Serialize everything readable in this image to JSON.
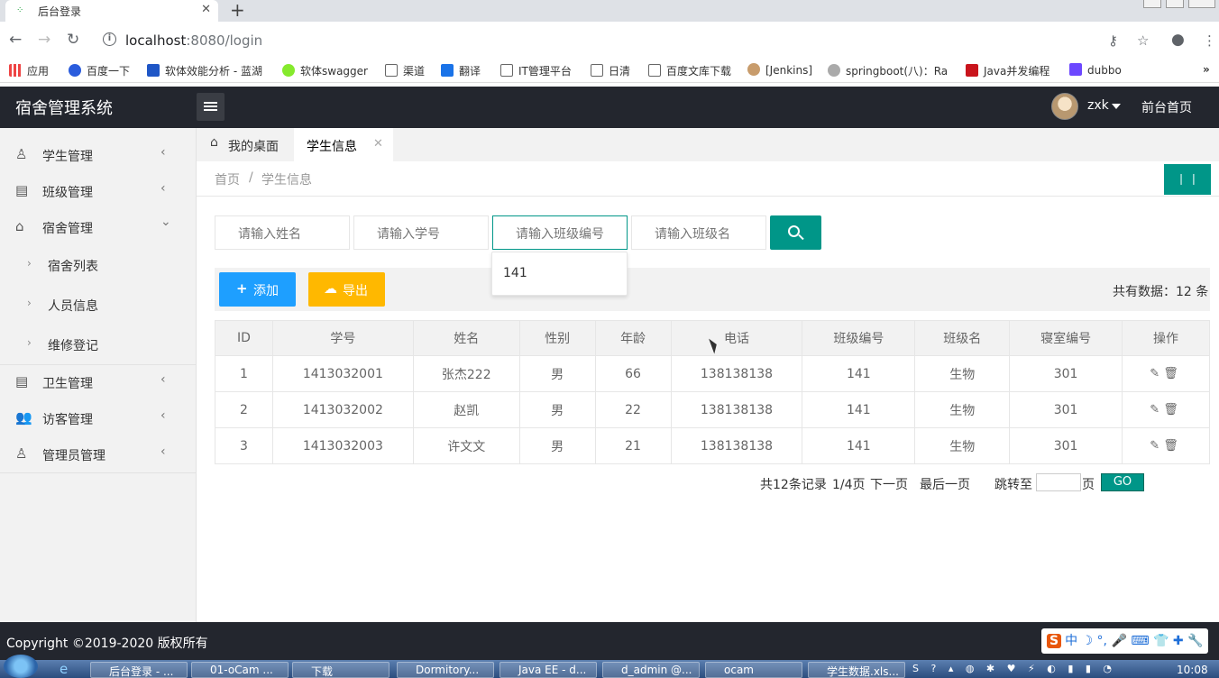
{
  "browser": {
    "tab_title": "后台登录",
    "url_host": "localhost",
    "url_path": ":8080/login",
    "bookmarks": [
      "应用",
      "百度一下",
      "软体效能分析 - 蓝湖",
      "软体swagger",
      "渠道",
      "翻译",
      "IT管理平台",
      "日清",
      "百度文库下载",
      "[Jenkins]",
      "springboot(八)：Ra",
      "Java并发编程",
      "dubbo"
    ]
  },
  "header": {
    "logo": "宿舍管理系统",
    "username": "zxk",
    "home_link": "前台首页"
  },
  "sidebar": {
    "items": [
      {
        "label": "学生管理",
        "icon": "user-icon"
      },
      {
        "label": "班级管理",
        "icon": "class-icon"
      },
      {
        "label": "宿舍管理",
        "icon": "dorm-icon"
      },
      {
        "label": "卫生管理",
        "icon": "doc-icon"
      },
      {
        "label": "访客管理",
        "icon": "visitors-icon"
      },
      {
        "label": "管理员管理",
        "icon": "admin-icon"
      }
    ],
    "subitems": [
      "宿舍列表",
      "人员信息",
      "维修登记"
    ]
  },
  "tabs": {
    "desk": "我的桌面",
    "active": "学生信息"
  },
  "breadcrumb": {
    "home": "首页",
    "sep": "/",
    "current": "学生信息"
  },
  "search": {
    "name_placeholder": "请输入姓名",
    "id_placeholder": "请输入学号",
    "class_no_placeholder": "请输入班级编号",
    "class_name_placeholder": "请输入班级名",
    "suggestion": "141"
  },
  "actions": {
    "add": "添加",
    "export": "导出",
    "total": "共有数据：12 条"
  },
  "table": {
    "headers": [
      "ID",
      "学号",
      "姓名",
      "性别",
      "年龄",
      "电话",
      "班级编号",
      "班级名",
      "寝室编号",
      "操作"
    ],
    "rows": [
      [
        "1",
        "1413032001",
        "张杰222",
        "男",
        "66",
        "138138138",
        "141",
        "生物",
        "301"
      ],
      [
        "2",
        "1413032002",
        "赵凯",
        "男",
        "22",
        "138138138",
        "141",
        "生物",
        "301"
      ],
      [
        "3",
        "1413032003",
        "许文文",
        "男",
        "21",
        "138138138",
        "141",
        "生物",
        "301"
      ]
    ]
  },
  "pager": {
    "records": "共12条记录",
    "page": "1/4页",
    "next": "下一页",
    "last": "最后一页",
    "jump": "跳转至",
    "page_unit": "页",
    "go": "GO"
  },
  "footer": {
    "copyright": "Copyright ©2019-2020 版权所有"
  },
  "ime": {
    "brand": "S",
    "text": "中 ☽ °, 🎤 ⌨ 👕 ✚ 🔧"
  },
  "taskbar": {
    "items": [
      "后台登录 - ...",
      "01-oCam ...",
      "下载",
      "Dormitory...",
      "Java EE - d...",
      "d_admin @...",
      "ocam",
      "学生数据.xls..."
    ],
    "time": "10:08"
  },
  "colors": {
    "header_bg": "#23262e",
    "accent": "#009688",
    "add_button": "#1e9fff",
    "export_button": "#ffb800"
  }
}
